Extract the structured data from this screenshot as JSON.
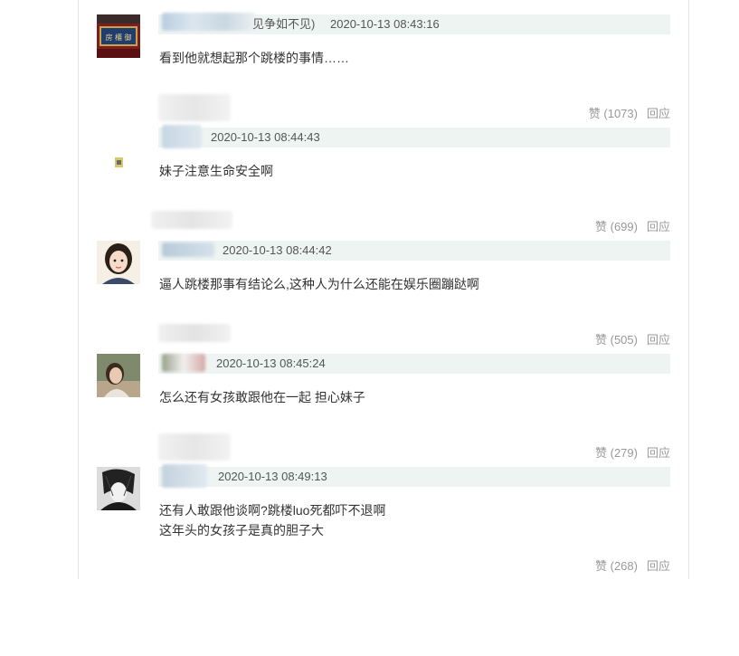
{
  "comments": [
    {
      "name_suffix": "见争如不见)",
      "timestamp": "2020-10-13 08:43:16",
      "text_lines": [
        "看到他就想起那个跳楼的事情……"
      ]
    },
    {
      "likes": "赞 (1073)",
      "reply": "回应",
      "timestamp": "2020-10-13 08:44:43",
      "text_lines": [
        "妹子注意生命安全啊"
      ]
    },
    {
      "likes": "赞 (699)",
      "reply": "回应",
      "timestamp": "2020-10-13 08:44:42",
      "text_lines": [
        "逼人跳楼那事有结论么,这种人为什么还能在娱乐圈蹦跶啊"
      ]
    },
    {
      "likes": "赞 (505)",
      "reply": "回应",
      "timestamp": "2020-10-13 08:45:24",
      "text_lines": [
        "怎么还有女孩敢跟他在一起 担心妹子"
      ]
    },
    {
      "likes": "赞 (279)",
      "reply": "回应",
      "timestamp": "2020-10-13 08:49:13",
      "text_lines": [
        "还有人敢跟他谈啊?跳楼luo死都吓不退啊",
        "这年头的女孩子是真的胆子大"
      ]
    },
    {
      "likes": "赞 (268)",
      "reply": "回应"
    }
  ]
}
